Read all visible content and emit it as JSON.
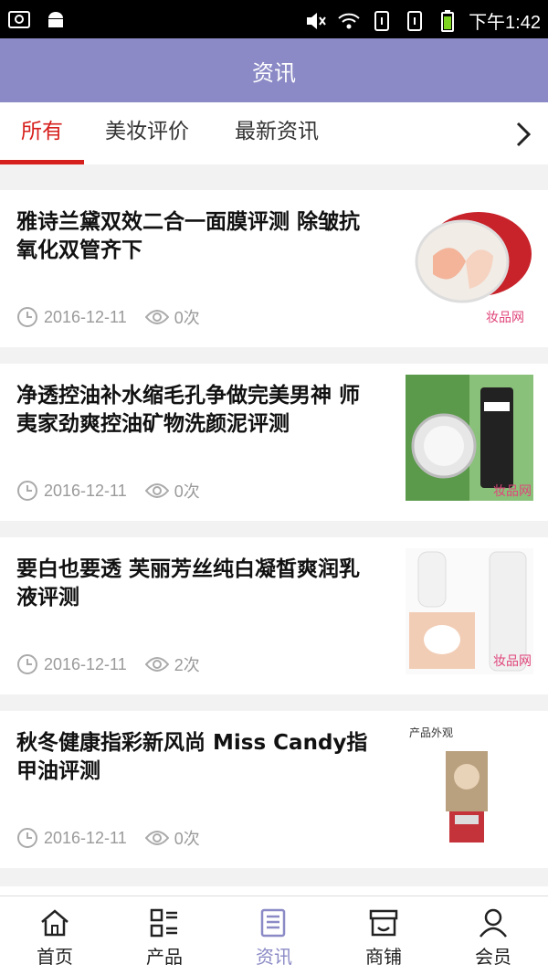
{
  "status_bar": {
    "time": "下午1:42"
  },
  "header": {
    "title": "资讯"
  },
  "tabs": [
    {
      "label": "所有",
      "active": true
    },
    {
      "label": "美妆评价",
      "active": false
    },
    {
      "label": "最新资讯",
      "active": false
    }
  ],
  "articles": [
    {
      "title": "雅诗兰黛双效二合一面膜评测 除皱抗氧化双管齐下",
      "date": "2016-12-11",
      "views": "0次",
      "thumb_icon": "cream-jar-image",
      "watermark": "妆品网"
    },
    {
      "title": "净透控油补水缩毛孔争做完美男神 师夷家劲爽控油矿物洗颜泥评测",
      "date": "2016-12-11",
      "views": "0次",
      "thumb_icon": "cleanser-tube-image",
      "watermark": "妆品网"
    },
    {
      "title": "要白也要透 芙丽芳丝纯白凝皙爽润乳液评测",
      "date": "2016-12-11",
      "views": "2次",
      "thumb_icon": "lotion-bottle-image",
      "watermark": "妆品网"
    },
    {
      "title": "秋冬健康指彩新风尚 Miss Candy指甲油评测",
      "date": "2016-12-11",
      "views": "0次",
      "thumb_icon": "nail-polish-image",
      "watermark": "产品外观"
    }
  ],
  "bottom_nav": [
    {
      "label": "首页",
      "icon": "home-icon",
      "active": false
    },
    {
      "label": "产品",
      "icon": "grid-list-icon",
      "active": false
    },
    {
      "label": "资讯",
      "icon": "news-icon",
      "active": true
    },
    {
      "label": "商铺",
      "icon": "shop-icon",
      "active": false
    },
    {
      "label": "会员",
      "icon": "user-icon",
      "active": false
    }
  ],
  "colors": {
    "header": "#8b8ac6",
    "accent": "#d6201d",
    "meta": "#9a9a9a"
  }
}
